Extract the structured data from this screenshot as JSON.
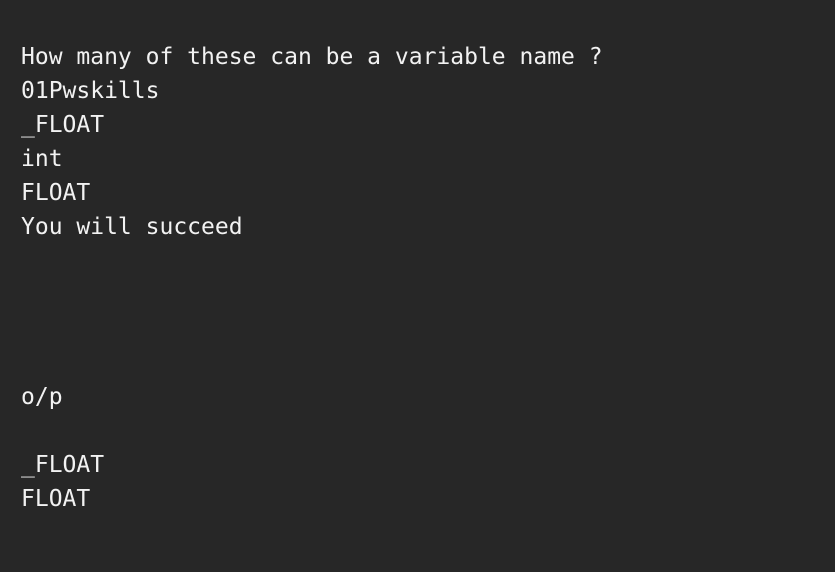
{
  "editor": {
    "lines": [
      "How many of these can be a variable name ?",
      "01Pwskills",
      "_FLOAT",
      "int",
      "FLOAT",
      "You will succeed",
      "o/p",
      "_FLOAT",
      "FLOAT"
    ]
  },
  "colors": {
    "background": "#272727",
    "text": "#f2f2f2"
  }
}
